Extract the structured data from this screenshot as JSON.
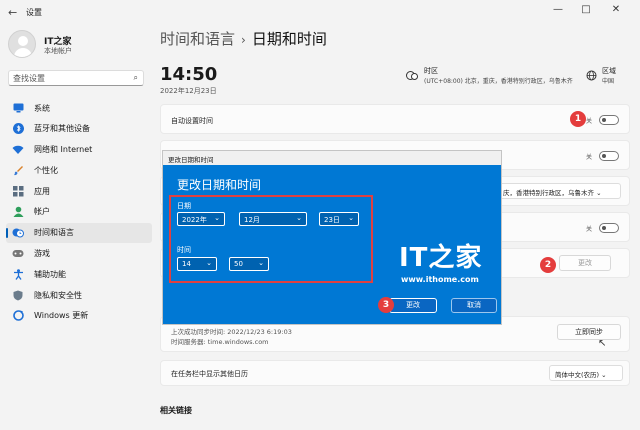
{
  "window": {
    "title": "设置",
    "back_icon": "←",
    "min_icon": "—",
    "max_icon": "□",
    "close_icon": "✕"
  },
  "profile": {
    "name": "IT之家",
    "subtitle": "本地帐户"
  },
  "search": {
    "placeholder": "查找设置",
    "icon": "⌕"
  },
  "sidebar": {
    "items": [
      {
        "label": "系统",
        "icon": "monitor-icon",
        "color": "#1e6fd6"
      },
      {
        "label": "蓝牙和其他设备",
        "icon": "bluetooth-icon",
        "color": "#1e6fd6"
      },
      {
        "label": "网络和 Internet",
        "icon": "wifi-icon",
        "color": "#1e6fd6"
      },
      {
        "label": "个性化",
        "icon": "brush-icon",
        "color": "#d9822b"
      },
      {
        "label": "应用",
        "icon": "apps-icon",
        "color": "#5a6d80"
      },
      {
        "label": "帐户",
        "icon": "person-icon",
        "color": "#2e9e5b"
      },
      {
        "label": "时间和语言",
        "icon": "clock-globe-icon",
        "color": "#1e6fd6"
      },
      {
        "label": "游戏",
        "icon": "gamepad-icon",
        "color": "#666666"
      },
      {
        "label": "辅助功能",
        "icon": "accessibility-icon",
        "color": "#1e6fd6"
      },
      {
        "label": "隐私和安全性",
        "icon": "shield-icon",
        "color": "#6b7c8c"
      },
      {
        "label": "Windows 更新",
        "icon": "update-icon",
        "color": "#1e6fd6"
      }
    ],
    "active_index": 6
  },
  "header": {
    "parent": "时间和语言",
    "separator": "›",
    "current": "日期和时间"
  },
  "clock": {
    "time": "14:50",
    "date": "2022年12月23日"
  },
  "timezone": {
    "label": "时区",
    "value": "(UTC+08:00) 北京，重庆，香港特别行政区，乌鲁木齐"
  },
  "region": {
    "label": "区域",
    "value": "中国"
  },
  "settings": {
    "auto_time_label": "自动设置时间",
    "off_label": "关",
    "timezone_value": "庆，香港特别行政区，乌鲁木齐",
    "change_label": "更改",
    "last_sync": "上次成功同步时间: 2022/12/23 6:19:03",
    "time_server": "时间服务器: time.windows.com",
    "sync_now": "立即同步",
    "taskbar_calendar_label": "在任务栏中显示其他日历",
    "calendar_value": "简体中文(农历)",
    "related_links": "相关链接"
  },
  "markers": {
    "m1": "1",
    "m2": "2",
    "m3": "3"
  },
  "dialog": {
    "window_title": "更改日期和时间",
    "heading": "更改日期和时间",
    "date_label": "日期",
    "year": "2022年",
    "month": "12月",
    "day": "23日",
    "time_label": "时间",
    "hour": "14",
    "minute": "50",
    "chevron": "⌄",
    "logo_mark": "IT之家",
    "logo_url": "www.ithome.com",
    "change_button": "更改",
    "cancel_button": "取消"
  }
}
